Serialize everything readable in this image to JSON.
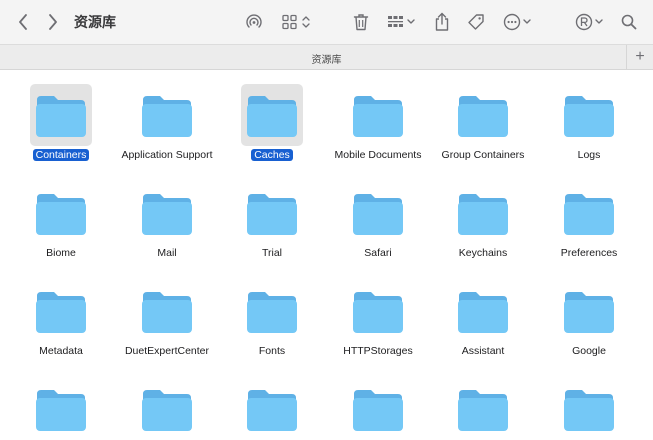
{
  "window": {
    "title": "资源库",
    "tab_label": "资源库",
    "tab_add": "+"
  },
  "toolbar": {
    "icons": [
      "chevron-left-icon",
      "chevron-right-icon",
      "airdrop-icon",
      "view-grid-icon",
      "trash-icon",
      "group-icon",
      "share-icon",
      "tag-icon",
      "more-icon",
      "profile-icon",
      "search-icon"
    ]
  },
  "files": {
    "row1": [
      {
        "name": "Containers",
        "selected": true
      },
      {
        "name": "Application Support",
        "selected": false
      },
      {
        "name": "Caches",
        "selected": true
      },
      {
        "name": "Mobile Documents",
        "selected": false
      },
      {
        "name": "Group Containers",
        "selected": false
      },
      {
        "name": "Logs",
        "selected": false
      }
    ],
    "row2": [
      {
        "name": "Biome"
      },
      {
        "name": "Mail"
      },
      {
        "name": "Trial"
      },
      {
        "name": "Safari"
      },
      {
        "name": "Keychains"
      },
      {
        "name": "Preferences"
      }
    ],
    "row3": [
      {
        "name": "Metadata"
      },
      {
        "name": "DuetExpertCenter"
      },
      {
        "name": "Fonts"
      },
      {
        "name": "HTTPStorages"
      },
      {
        "name": "Assistant"
      },
      {
        "name": "Google"
      }
    ]
  },
  "colors": {
    "folder_top": "#63b3e8",
    "folder_body": "#74c7f5",
    "selection": "#1860d1",
    "icon_selection_bg": "#e3e3e3"
  }
}
